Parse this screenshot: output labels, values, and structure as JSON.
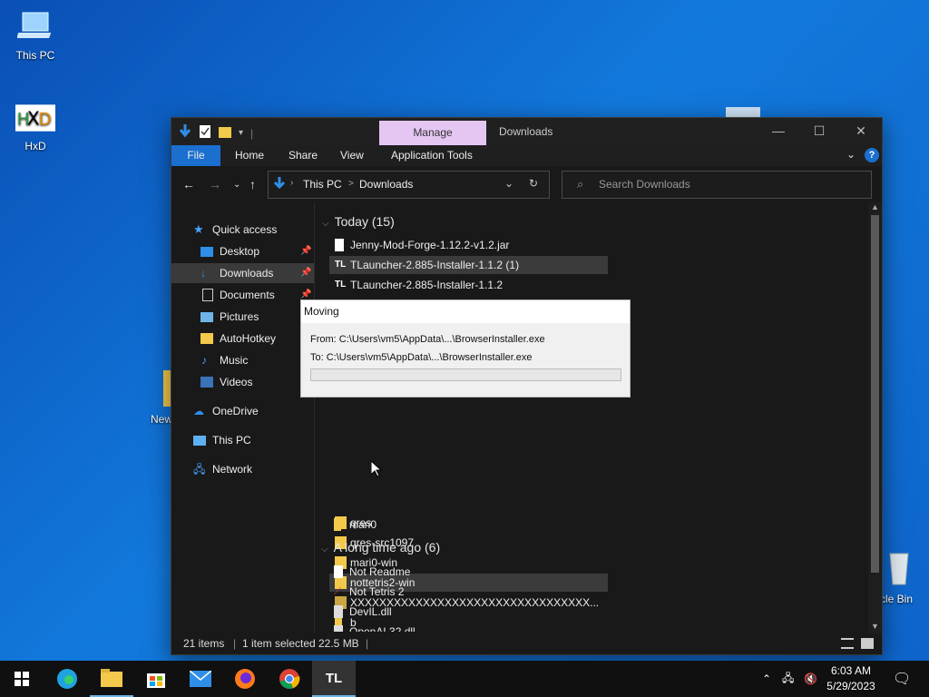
{
  "desktop": {
    "icons": [
      {
        "label": "This PC"
      },
      {
        "label": "HxD"
      },
      {
        "label": "New"
      },
      {
        "label": "cle Bin"
      }
    ]
  },
  "explorer": {
    "quick_access_toolbar": {
      "separator": "|"
    },
    "manage_tab": "Manage",
    "title": "Downloads",
    "ribbon": {
      "file": "File",
      "home": "Home",
      "share": "Share",
      "view": "View",
      "app_tools": "Application Tools"
    },
    "address": {
      "root": "This PC",
      "sep": ">",
      "current": "Downloads"
    },
    "search": {
      "placeholder": "Search Downloads"
    },
    "nav": {
      "quick_access": "Quick access",
      "desktop": "Desktop",
      "downloads": "Downloads",
      "documents": "Documents",
      "pictures": "Pictures",
      "autohotkey": "AutoHotkey",
      "music": "Music",
      "videos": "Videos",
      "onedrive": "OneDrive",
      "thispc": "This PC",
      "network": "Network"
    },
    "groups": {
      "today": "Today (15)",
      "longago": "A long time ago (6)"
    },
    "files": {
      "f1": "Jenny-Mod-Forge-1.12.2-v1.2.jar",
      "f2": "TLauncher-2.885-Installer-1.1.2 (1)",
      "f3": "TLauncher-2.885-Installer-1.1.2",
      "f4": "qres",
      "f5": "qres-src1097",
      "f6": "mari0-win",
      "f7": "nottetris2-win",
      "f8": "XXXXXXXXXXXXXXXXXXXXXXXXXXXXXXXXX...",
      "f9": "b",
      "f10": "mari0",
      "f11": "Not Readme",
      "f12": "Not Tetris 2",
      "f13": "DevIL.dll",
      "f14": "OpenAL32.dll"
    },
    "status": {
      "items": "21 items",
      "selected": "1 item selected",
      "size": "22.5 MB"
    }
  },
  "dialog": {
    "title": "Moving",
    "from": "From: C:\\Users\\vm5\\AppData\\...\\BrowserInstaller.exe",
    "to": "To: C:\\Users\\vm5\\AppData\\...\\BrowserInstaller.exe",
    "progress_fraction": 0.0
  },
  "taskbar": {
    "tl_label": "TL",
    "time": "6:03 AM",
    "date": "5/29/2023"
  },
  "colors": {
    "accent": "#1a6fcf",
    "manage_tab": "#e5c6f3",
    "folder": "#f3c94b"
  }
}
